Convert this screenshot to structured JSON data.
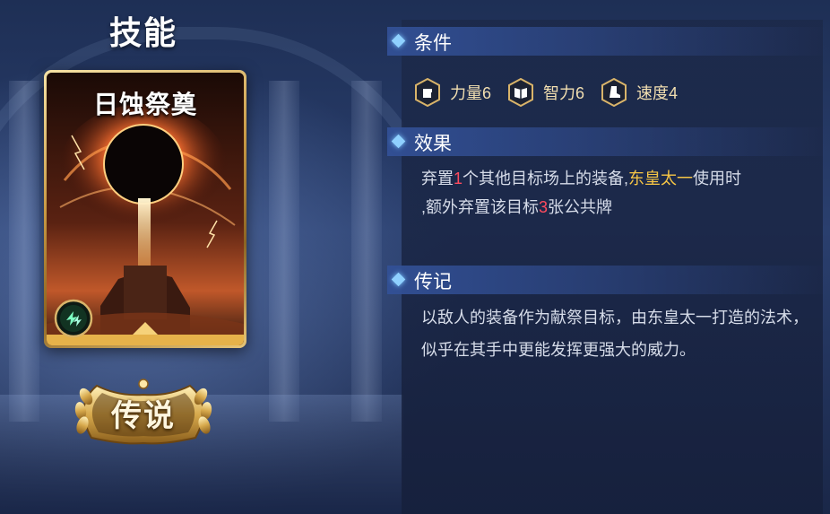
{
  "page": {
    "title": "技能"
  },
  "card": {
    "name": "日蚀祭奠",
    "rarity": "传说",
    "type_icon": "lightning-icon"
  },
  "sections": {
    "conditions": {
      "title": "条件",
      "items": [
        {
          "icon": "fist-icon",
          "label": "力量6"
        },
        {
          "icon": "book-icon",
          "label": "智力6"
        },
        {
          "icon": "boot-icon",
          "label": "速度4"
        }
      ]
    },
    "effect": {
      "title": "效果",
      "segments": [
        "弃置",
        "1",
        "个其他目标场上的装备,",
        "东皇太一",
        "使用时",
        ",额外弃置该目标",
        "3",
        "张公共牌"
      ]
    },
    "lore": {
      "title": "传记",
      "text": "以敌人的装备作为献祭目标，由东皇太一打造的法术，似乎在其手中更能发挥更强大的威力。"
    }
  },
  "colors": {
    "highlight_number": "#ff4b5e",
    "highlight_name": "#f6c545",
    "requirement_text": "#f2dfb0",
    "body_text": "#d6dce9"
  }
}
